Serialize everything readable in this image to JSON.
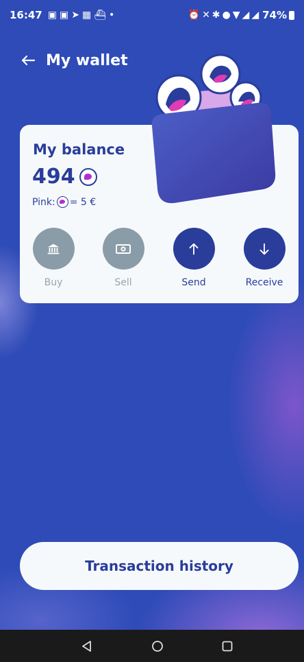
{
  "status_bar": {
    "time": "16:47",
    "notification_icons": [
      "teams-icon",
      "linkedin-icon",
      "telegram-icon",
      "calendar-icon",
      "boat-icon",
      "dot"
    ],
    "system_icons": [
      "alarm-icon",
      "mute-icon",
      "bluetooth-icon",
      "location-icon",
      "wifi-icon",
      "signal-icon",
      "signal-icon"
    ],
    "battery": "74%"
  },
  "header": {
    "back_icon": "arrow-left-icon",
    "title": "My wallet"
  },
  "balance_card": {
    "title": "My balance",
    "amount": "494",
    "rate_prefix": "Pink:",
    "rate_suffix": "= 5 €"
  },
  "actions": [
    {
      "label": "Buy",
      "icon": "bank-icon",
      "enabled": false
    },
    {
      "label": "Sell",
      "icon": "banknote-icon",
      "enabled": false
    },
    {
      "label": "Send",
      "icon": "arrow-up-icon",
      "enabled": true
    },
    {
      "label": "Receive",
      "icon": "arrow-down-icon",
      "enabled": true
    }
  ],
  "history_button": {
    "label": "Transaction history"
  },
  "nav_bar": {
    "buttons": [
      "back-triangle-icon",
      "home-circle-icon",
      "recents-square-icon"
    ]
  },
  "colors": {
    "background": "#2e4bb7",
    "primary": "#2a3d9b",
    "card": "#f6f9fb",
    "disabled": "#8a9ca8",
    "accent_pink": "#d43bc0"
  }
}
